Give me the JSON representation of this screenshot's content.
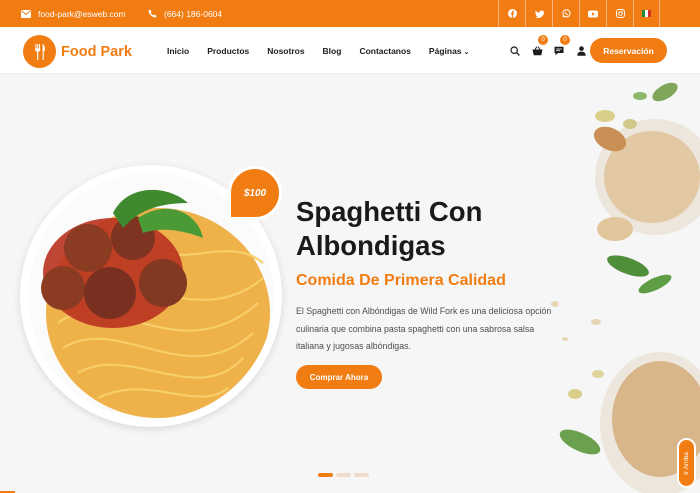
{
  "topbar": {
    "email": "food-park@esweb.com",
    "phone": "(664) 186-0604",
    "socials": [
      {
        "icon": "facebook-icon"
      },
      {
        "icon": "twitter-icon"
      },
      {
        "icon": "whatsapp-icon"
      },
      {
        "icon": "youtube-icon"
      },
      {
        "icon": "instagram-icon"
      },
      {
        "icon": "mexico-flag-icon"
      }
    ]
  },
  "brand": {
    "name": "Food Park",
    "color": "#f07c12"
  },
  "nav": {
    "items": [
      "Inicio",
      "Productos",
      "Nosotros",
      "Blog",
      "Contactanos",
      "Páginas"
    ],
    "cart_count": "0",
    "messages_count": "0",
    "reserve_label": "Reservación"
  },
  "hero": {
    "price": "$100",
    "title": "Spaghetti Con Albondigas",
    "subtitle": "Comida De Primera Calidad",
    "description": "El Spaghetti con Albóndigas de Wild Fork es una deliciosa opción culinaria que combina pasta spaghetti con una sabrosa salsa italiana y jugosas albóndigas.",
    "button_label": "Comprar Ahora",
    "slides": 3,
    "active_slide": 1
  },
  "back_to_top": "Ir Arriba"
}
